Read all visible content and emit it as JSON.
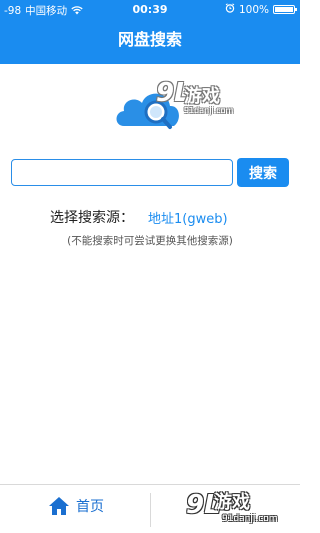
{
  "status_bar": {
    "signal": "-98",
    "carrier": "中国移动",
    "time": "00:39",
    "battery": "100%",
    "battery_level": 1.0,
    "icons": [
      "wifi-icon",
      "alarm-icon",
      "battery-icon"
    ]
  },
  "nav": {
    "title": "网盘搜索"
  },
  "logo": {
    "icon": "cloud-search-icon",
    "mark": "9L",
    "text": "游戏",
    "sub": "91danji.com"
  },
  "search": {
    "value": "",
    "placeholder": "",
    "button_label": "搜索"
  },
  "source": {
    "label": "选择搜索源：",
    "selected": "地址1(gweb)"
  },
  "hint": "(不能搜索时可尝试更换其他搜索源)",
  "tab_bar": {
    "home_label": "首页",
    "home_icon": "home-icon"
  },
  "watermark": {
    "mark": "9L",
    "text": "游戏",
    "sub": "91danji.com"
  },
  "colors": {
    "primary": "#1a8cf0",
    "text": "#222222",
    "hint": "#555555"
  }
}
